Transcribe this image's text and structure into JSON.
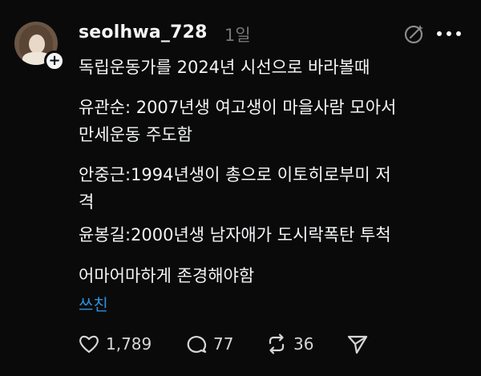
{
  "post": {
    "username": "seolhwa_728",
    "time": "1일",
    "lines": [
      "독립운동가를 2024년 시선으로 바라볼때",
      "유관순: 2007년생 여고생이 마을사람 모아서",
      "만세운동 주도함",
      "안중근:1994년생이 총으로 이토히로부미 저",
      "격",
      "윤봉길:2000년생 남자애가 도시락폭탄 투척",
      "어마어마하게 존경해야함"
    ],
    "translate_label": "쓰친"
  },
  "actions": {
    "like_count": "1,789",
    "reply_count": "77",
    "repost_count": "36"
  },
  "icons": {
    "avatar": "avatar",
    "follow": "plus-icon",
    "ai": "ai-sparkle-icon",
    "more": "more-icon",
    "like": "heart-icon",
    "reply": "comment-icon",
    "repost": "repost-icon",
    "share": "send-icon"
  },
  "colors": {
    "background": "#0a0a0a",
    "text": "#f3f5f7",
    "muted": "#777777",
    "link": "#2f8fdc"
  }
}
